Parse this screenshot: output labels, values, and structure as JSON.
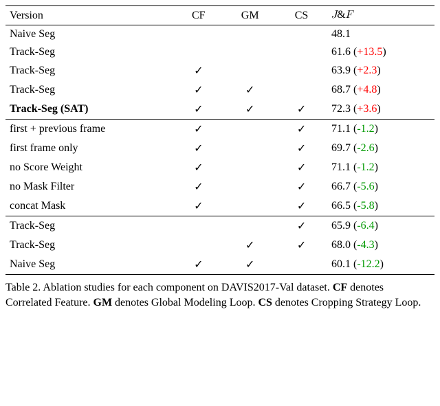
{
  "chart_data": {
    "type": "table",
    "title": "Table 2. Ablation studies for each component on DAVIS2017-Val dataset.",
    "columns": [
      "Version",
      "CF",
      "GM",
      "CS",
      "J&F"
    ],
    "column_notes": {
      "CF": "Correlated Feature",
      "GM": "Global Modeling Loop",
      "CS": "Cropping Strategy Loop"
    },
    "sections": [
      {
        "rows": [
          {
            "version": "Naive Seg",
            "CF": false,
            "GM": false,
            "CS": false,
            "JF": 48.1,
            "delta": null
          },
          {
            "version": "Track-Seg",
            "CF": false,
            "GM": false,
            "CS": false,
            "JF": 61.6,
            "delta": 13.5
          },
          {
            "version": "Track-Seg",
            "CF": true,
            "GM": false,
            "CS": false,
            "JF": 63.9,
            "delta": 2.3
          },
          {
            "version": "Track-Seg",
            "CF": true,
            "GM": true,
            "CS": false,
            "JF": 68.7,
            "delta": 4.8
          },
          {
            "version": "Track-Seg (SAT)",
            "CF": true,
            "GM": true,
            "CS": true,
            "JF": 72.3,
            "delta": 3.6,
            "bold": true
          }
        ]
      },
      {
        "rows": [
          {
            "version": "first + previous frame",
            "CF": true,
            "GM": false,
            "CS": true,
            "JF": 71.1,
            "delta": -1.2
          },
          {
            "version": "first frame only",
            "CF": true,
            "GM": false,
            "CS": true,
            "JF": 69.7,
            "delta": -2.6
          },
          {
            "version": "no Score Weight",
            "CF": true,
            "GM": false,
            "CS": true,
            "JF": 71.1,
            "delta": -1.2
          },
          {
            "version": "no Mask Filter",
            "CF": true,
            "GM": false,
            "CS": true,
            "JF": 66.7,
            "delta": -5.6
          },
          {
            "version": "concat Mask",
            "CF": true,
            "GM": false,
            "CS": true,
            "JF": 66.5,
            "delta": -5.8
          }
        ]
      },
      {
        "rows": [
          {
            "version": "Track-Seg",
            "CF": false,
            "GM": false,
            "CS": true,
            "JF": 65.9,
            "delta": -6.4
          },
          {
            "version": "Track-Seg",
            "CF": false,
            "GM": true,
            "CS": true,
            "JF": 68.0,
            "delta": -4.3
          },
          {
            "version": "Naive Seg",
            "CF": true,
            "GM": true,
            "CS": false,
            "JF": 60.1,
            "delta": -12.2
          }
        ]
      }
    ]
  },
  "headers": {
    "version": "Version",
    "cf": "CF",
    "gm": "GM",
    "cs": "CS",
    "jf_html": "<span class=\"script\">J</span>&amp;<span class=\"script\">F</span>"
  },
  "glyphs": {
    "check": "✓"
  },
  "caption_html": "Table 2. Ablation studies for each component on DAVIS2017-Val dataset. <b>CF</b> denotes Correlated Feature. <b>GM</b> denotes Global Modeling Loop. <b>CS</b> denotes Cropping Strategy Loop."
}
